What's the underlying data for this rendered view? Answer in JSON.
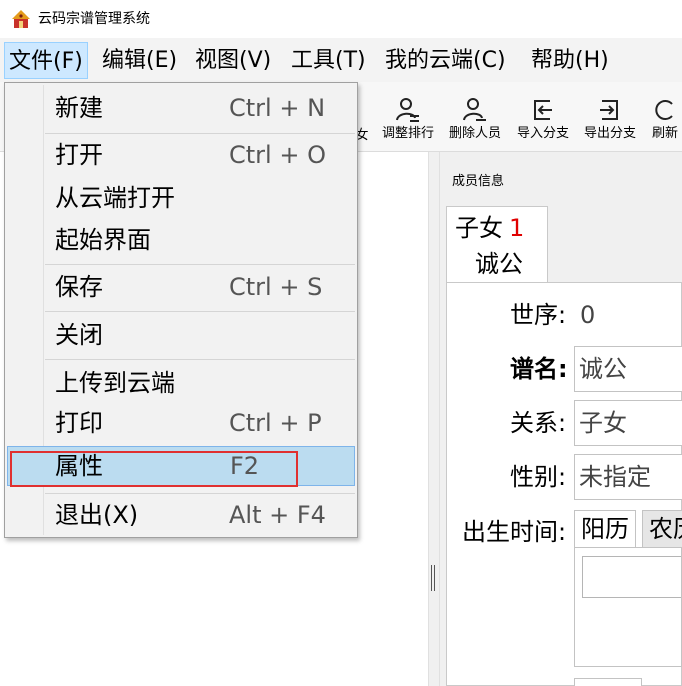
{
  "window": {
    "title": "云码宗谱管理系统",
    "icon": "temple-icon"
  },
  "menubar": {
    "items": [
      "文件(F)",
      "编辑(E)",
      "视图(V)",
      "工具(T)",
      "我的云端(C)",
      "帮助(H)"
    ],
    "active": "文件(F)"
  },
  "toolbar": {
    "partial_label": "女",
    "buttons": [
      {
        "label": "调整排行",
        "icon": "person-sort-icon"
      },
      {
        "label": "删除人员",
        "icon": "person-remove-icon"
      },
      {
        "label": "导入分支",
        "icon": "import-icon"
      },
      {
        "label": "导出分支",
        "icon": "export-icon"
      },
      {
        "label": "刷新",
        "icon": "refresh-icon"
      }
    ]
  },
  "file_menu": {
    "items": [
      {
        "label": "新建",
        "shortcut": "Ctrl + N"
      },
      {
        "label": "打开",
        "shortcut": "Ctrl + O"
      },
      {
        "label": "从云端打开",
        "shortcut": ""
      },
      {
        "label": "起始界面",
        "shortcut": ""
      },
      {
        "label": "保存",
        "shortcut": "Ctrl + S"
      },
      {
        "label": "关闭",
        "shortcut": ""
      },
      {
        "label": "上传到云端",
        "shortcut": ""
      },
      {
        "label": "打印",
        "shortcut": "Ctrl + P"
      },
      {
        "label": "属性",
        "shortcut": "F2"
      },
      {
        "label": "退出(X)",
        "shortcut": "Alt + F4"
      }
    ],
    "highlighted": "属性",
    "highlight_color": "#bbdcf0",
    "annotation_color": "#e03030"
  },
  "member_info": {
    "section_title": "成员信息",
    "tab": {
      "title": "子女",
      "count": "1",
      "name": "诚公"
    },
    "fields": {
      "generation_label": "世序:",
      "generation_value": "0",
      "name_label": "谱名:",
      "name_value": "诚公",
      "relation_label": "关系:",
      "relation_value": "子女",
      "gender_label": "性别:",
      "gender_value": "未指定",
      "birth_label": "出生时间:",
      "calendar_tabs": [
        "阳历",
        "农历"
      ]
    }
  }
}
